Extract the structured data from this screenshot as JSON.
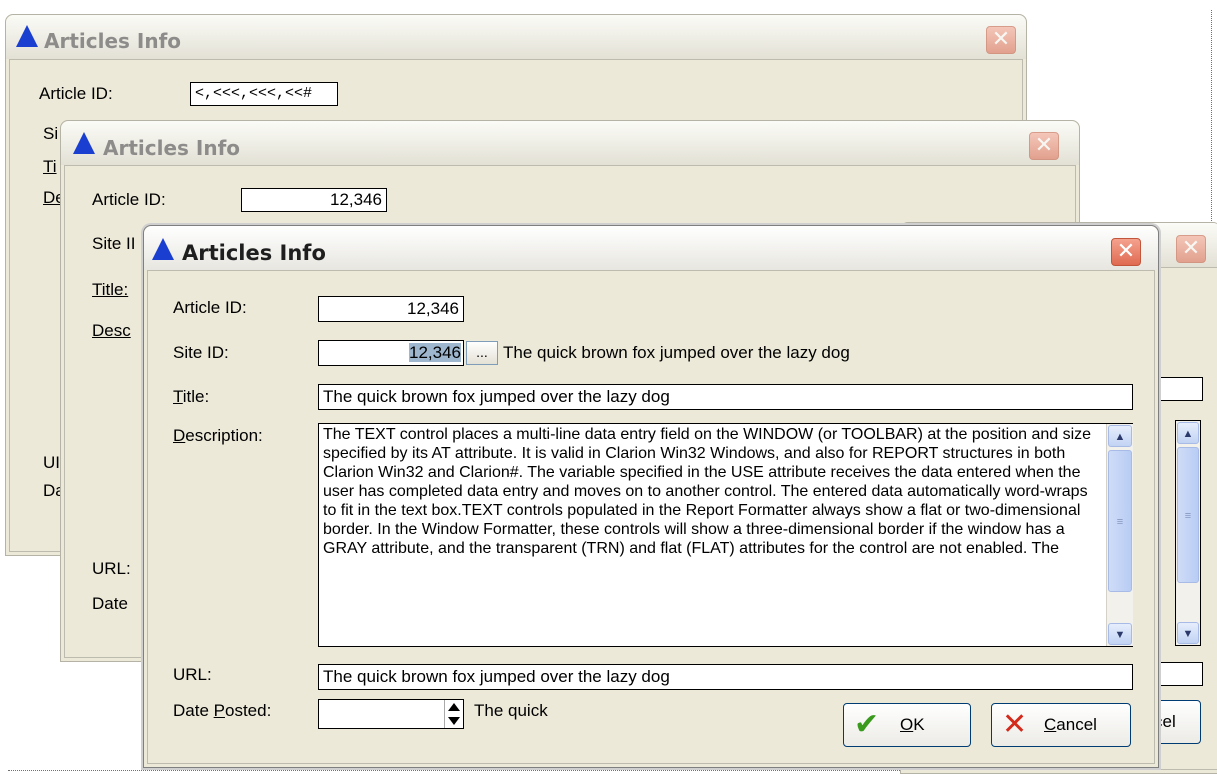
{
  "window_title": "Articles Info",
  "close_glyph": "✕",
  "labels": {
    "article_id": "Article ID:",
    "site_id": "Site ID:",
    "title_accel": "T",
    "title_rest": "itle:",
    "desc_accel": "D",
    "desc_rest": "escription:",
    "url": "URL:",
    "date_pre": "Date ",
    "date_accel": "P",
    "date_rest": "osted:"
  },
  "back_window": {
    "article_id_value": "<,<<<,<<<,<<#",
    "site_label_partial": "Si",
    "title_label_partial": "Ti",
    "desc_label_partial": "De",
    "url_label_partial": "UI",
    "date_label_partial": "Da"
  },
  "middle_window": {
    "article_id_label": "Article ID:",
    "article_id_value": "12,346",
    "site_label_partial": "Site II",
    "title_label_partial": "Title:",
    "desc_label_partial": "Desc",
    "url_label": "URL:",
    "date_label_partial": "Date"
  },
  "front_window": {
    "article_id_value": "12,346",
    "site_id_value": "12,346",
    "lookup_button": "...",
    "site_description": "The quick brown fox jumped over the lazy dog",
    "title_value": "The quick brown fox jumped over the lazy dog",
    "description_text": "The TEXT control places a multi-line data entry field on the WINDOW (or TOOLBAR) at the position and size specified by its AT attribute. It is valid in Clarion Win32 Windows, and also for REPORT structures in both Clarion Win32 and Clarion#. The variable specified in the USE attribute receives the data entered when the user has completed data entry and moves on to another control. The entered data automatically word-wraps to fit in the text box.TEXT controls populated in the Report Formatter always show a flat or two-dimensional border. In the Window Formatter, these controls will show a three-dimensional border if the window has a GRAY attribute, and the transparent (TRN) and flat (FLAT) attributes for the control are not enabled. The",
    "url_value": "The quick brown fox jumped over the lazy dog",
    "date_value": "",
    "date_text": "The quick",
    "ok_accel": "O",
    "ok_rest": "K",
    "cancel_accel": "C",
    "cancel_rest": "ancel"
  },
  "right_window": {
    "cancel_partial": "cel"
  },
  "colors": {
    "title_icon": "#1a3ecf",
    "ok_check": "#3a9a1d",
    "cancel_x": "#d42a1c",
    "selection": "#9eb6ce"
  },
  "icons": [
    "app-triangle-icon",
    "close-icon",
    "checkmark-icon",
    "cancel-x-icon",
    "scroll-up-icon",
    "scroll-down-icon",
    "spin-icon"
  ]
}
